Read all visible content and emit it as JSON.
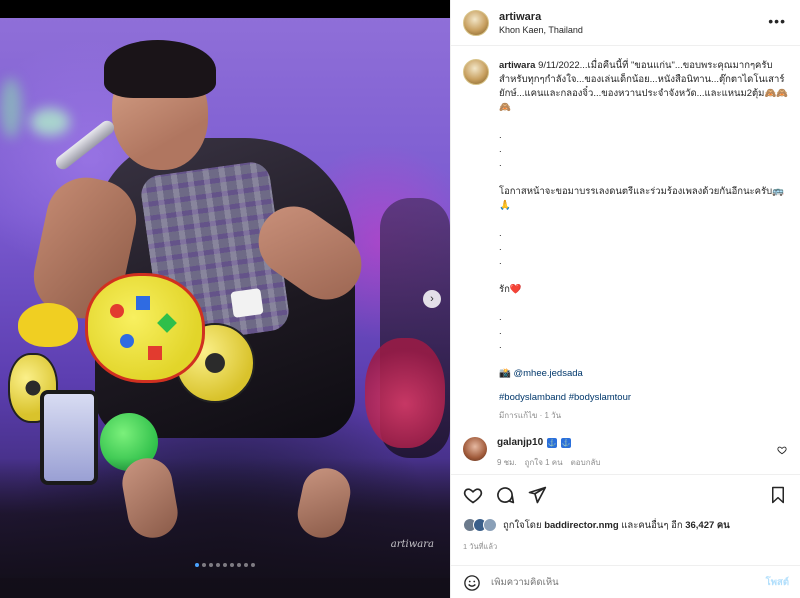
{
  "post": {
    "username": "artiwara",
    "location": "Khon Kaen, Thailand",
    "more_label": "•••",
    "signature": "artiwara"
  },
  "media": {
    "next_label": "›",
    "dot_count": 9,
    "active_dot": 1
  },
  "caption": {
    "username": "artiwara",
    "lines": [
      "9/11/2022...เมื่อคืนนี้ที่ \"ขอนแก่น\"...ขอบพระคุณมากๆครับ",
      "สำหรับทุกๆกำลังใจ...ของเล่นเด็กน้อย...หนังสือนิทาน...ตุ๊กตาไดโนเสาร์",
      "ยักษ์...แคนและกลองจิ๋ว...ของหวานประจำจังหวัด...และแหนม2ตุ้ม🙈🙈",
      "🙈",
      "",
      ".",
      ".",
      ".",
      "",
      "โอกาสหน้าจะขอมาบรรเลงดนตรีและร่วมร้องเพลงด้วยกันอีกนะครับ🚌",
      "🙏",
      "",
      ".",
      ".",
      ".",
      "",
      "รัก❤️",
      "",
      ".",
      ".",
      ".",
      ""
    ],
    "camera_emoji": "📸",
    "mention": "@mhee.jedsada",
    "hashtags": "#bodyslamband #bodyslamtour",
    "edited_meta": "มีการแก้ไข · 1 วัน"
  },
  "comment": {
    "username": "galanjp10",
    "badges": [
      "⚓",
      "⚓"
    ],
    "time": "9 ชม.",
    "likes": "ถูกใจ 1 คน",
    "reply": "ตอบกลับ"
  },
  "likes": {
    "prefix": "ถูกใจโดย",
    "user": "baddirector.nmg",
    "suffix": "และคนอื่นๆ อีก",
    "count": "36,427 คน"
  },
  "time_ago": "1 วันที่แล้ว",
  "add_comment": {
    "placeholder": "เพิ่มความคิดเห็น",
    "post_label": "โพสต์"
  },
  "colors": {
    "link": "#00376b",
    "muted": "#8e8e8e",
    "post_button": "#b2dffc",
    "carousel_active": "#4aa3ff"
  }
}
